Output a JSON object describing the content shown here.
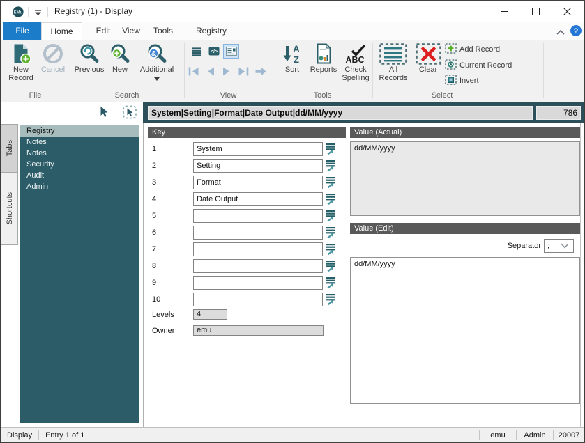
{
  "window": {
    "title": "Registry (1) - Display",
    "app_badge": "EMu"
  },
  "menu_tabs": [
    {
      "label": "File"
    },
    {
      "label": "Home"
    },
    {
      "label": "Edit"
    },
    {
      "label": "View"
    },
    {
      "label": "Tools"
    },
    {
      "label": "Registry"
    }
  ],
  "ribbon": {
    "file_group": {
      "label": "File",
      "new_record": "New Record",
      "cancel": "Cancel"
    },
    "search_group": {
      "label": "Search",
      "previous": "Previous",
      "new": "New",
      "additional": "Additional"
    },
    "view_group": {
      "label": "View"
    },
    "tools_group": {
      "label": "Tools",
      "sort": "Sort",
      "reports": "Reports",
      "check_spelling": "Check Spelling"
    },
    "select_group": {
      "label": "Select",
      "all_records": "All Records",
      "clear": "Clear",
      "add_record": "Add Record",
      "current_record": "Current Record",
      "invert": "Invert"
    }
  },
  "summary": {
    "text": "System|Setting|Format|Date Output|dd/MM/yyyy",
    "count": "786"
  },
  "sidebar": {
    "tabs": [
      {
        "label": "Tabs"
      },
      {
        "label": "Shortcuts"
      }
    ],
    "items": [
      {
        "label": "Registry"
      },
      {
        "label": "Notes"
      },
      {
        "label": "Notes"
      },
      {
        "label": "Security"
      },
      {
        "label": "Audit"
      },
      {
        "label": "Admin"
      }
    ]
  },
  "key_panel": {
    "title": "Key",
    "rows": [
      {
        "num": "1",
        "value": "System"
      },
      {
        "num": "2",
        "value": "Setting"
      },
      {
        "num": "3",
        "value": "Format"
      },
      {
        "num": "4",
        "value": "Date Output"
      },
      {
        "num": "5",
        "value": ""
      },
      {
        "num": "6",
        "value": ""
      },
      {
        "num": "7",
        "value": ""
      },
      {
        "num": "8",
        "value": ""
      },
      {
        "num": "9",
        "value": ""
      },
      {
        "num": "10",
        "value": ""
      }
    ],
    "levels_label": "Levels",
    "levels_value": "4",
    "owner_label": "Owner",
    "owner_value": "emu"
  },
  "value_actual": {
    "title": "Value (Actual)",
    "text": "dd/MM/yyyy"
  },
  "value_edit": {
    "title": "Value (Edit)",
    "separator_label": "Separator",
    "separator_value": ";",
    "text": "dd/MM/yyyy"
  },
  "status_bar": {
    "cells_left": [
      "Display",
      "Entry 1 of 1"
    ],
    "cells_right": [
      "emu",
      "Admin",
      "20007"
    ]
  }
}
